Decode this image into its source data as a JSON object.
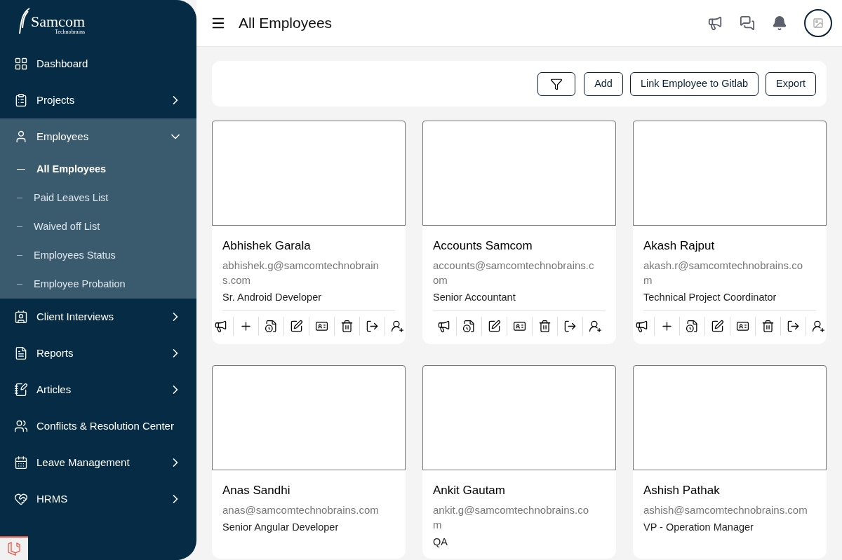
{
  "brand": {
    "name": "Samcom",
    "tagline": "Technobrains"
  },
  "sidebar": {
    "items": [
      {
        "label": "Dashboard",
        "kind": "link"
      },
      {
        "label": "Projects",
        "kind": "menu",
        "expanded": false
      },
      {
        "label": "Employees",
        "kind": "menu",
        "expanded": true,
        "children": [
          {
            "label": "All Employees",
            "selected": true
          },
          {
            "label": "Paid Leaves List",
            "selected": false
          },
          {
            "label": "Waived off List",
            "selected": false
          },
          {
            "label": "Employees Status",
            "selected": false
          },
          {
            "label": "Employee Probation",
            "selected": false
          }
        ]
      },
      {
        "label": "Client Interviews",
        "kind": "menu",
        "expanded": false
      },
      {
        "label": "Reports",
        "kind": "menu",
        "expanded": false
      },
      {
        "label": "Articles",
        "kind": "menu",
        "expanded": false
      },
      {
        "label": "Conflicts & Resolution Center",
        "kind": "link"
      },
      {
        "label": "Leave Management",
        "kind": "menu",
        "expanded": false
      },
      {
        "label": "HRMS",
        "kind": "menu",
        "expanded": false
      }
    ]
  },
  "header": {
    "title": "All Employees"
  },
  "toolbar": {
    "buttons": [
      {
        "kind": "filter"
      },
      {
        "kind": "text",
        "label": "Add"
      },
      {
        "kind": "text",
        "label": "Link Employee to Gitlab"
      },
      {
        "kind": "text",
        "label": "Export"
      }
    ]
  },
  "employees": [
    {
      "name": "Abhishek Garala",
      "email": "abhishek.g@samcomtechnobrains.com",
      "role": "Sr. Android Developer",
      "actions": [
        {
          "kind": "announce"
        },
        {
          "kind": "add"
        },
        {
          "kind": "log"
        },
        {
          "kind": "edit"
        },
        {
          "kind": "id"
        },
        {
          "kind": "delete"
        },
        {
          "kind": "exit"
        },
        {
          "kind": "user"
        }
      ]
    },
    {
      "name": "Accounts Samcom",
      "email": "accounts@samcomtechnobrains.com",
      "role": "Senior Accountant",
      "actions": [
        {
          "kind": "announce"
        },
        {
          "kind": "log"
        },
        {
          "kind": "edit"
        },
        {
          "kind": "id"
        },
        {
          "kind": "delete"
        },
        {
          "kind": "exit"
        },
        {
          "kind": "user"
        }
      ]
    },
    {
      "name": "Akash Rajput",
      "email": "akash.r@samcomtechnobrains.com",
      "role": "Technical Project Coordinator",
      "actions": [
        {
          "kind": "announce"
        },
        {
          "kind": "add"
        },
        {
          "kind": "log"
        },
        {
          "kind": "edit"
        },
        {
          "kind": "id"
        },
        {
          "kind": "delete"
        },
        {
          "kind": "exit"
        },
        {
          "kind": "user"
        }
      ]
    },
    {
      "name": "Anas Sandhi",
      "email": "anas@samcomtechnobrains.com",
      "role": "Senior Angular Developer"
    },
    {
      "name": "Ankit Gautam",
      "email": "ankit.g@samcomtechnobrains.com",
      "role": "QA"
    },
    {
      "name": "Ashish Pathak",
      "email": "ashish@samcomtechnobrains.com",
      "role": "VP - Operation Manager"
    }
  ]
}
